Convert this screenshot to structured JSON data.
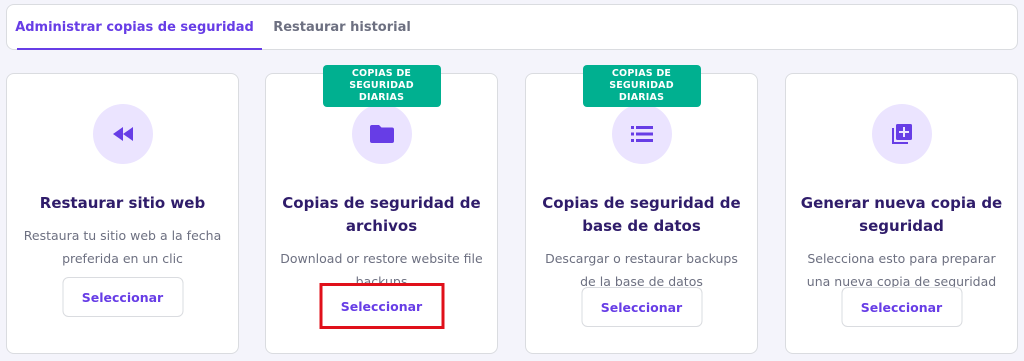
{
  "tabs": [
    {
      "label": "Administrar copias de seguridad",
      "active": true
    },
    {
      "label": "Restaurar historial",
      "active": false
    }
  ],
  "cards": [
    {
      "icon": "rewind-icon",
      "title": "Restaurar sitio web",
      "description": "Restaura tu sitio web a la fecha preferida en un clic",
      "button": "Seleccionar"
    },
    {
      "badge": "Copias de seguridad diarias",
      "icon": "folder-icon",
      "title": "Copias de seguridad de archivos",
      "description": "Download or restore website file backups",
      "button": "Seleccionar",
      "button_highlighted": true
    },
    {
      "badge": "Copias de seguridad diarias",
      "icon": "list-icon",
      "title": "Copias de seguridad de base de datos",
      "description": "Descargar o restaurar backups de la base de datos",
      "button": "Seleccionar"
    },
    {
      "icon": "add-copy-icon",
      "title": "Generar nueva copia de seguridad",
      "description": "Selecciona esto para preparar una nueva copia de seguridad",
      "button": "Seleccionar"
    }
  ],
  "colors": {
    "accent": "#673de6",
    "badge": "#00b090",
    "icon_bg": "#ebe4ff",
    "highlight": "#e0101a"
  }
}
